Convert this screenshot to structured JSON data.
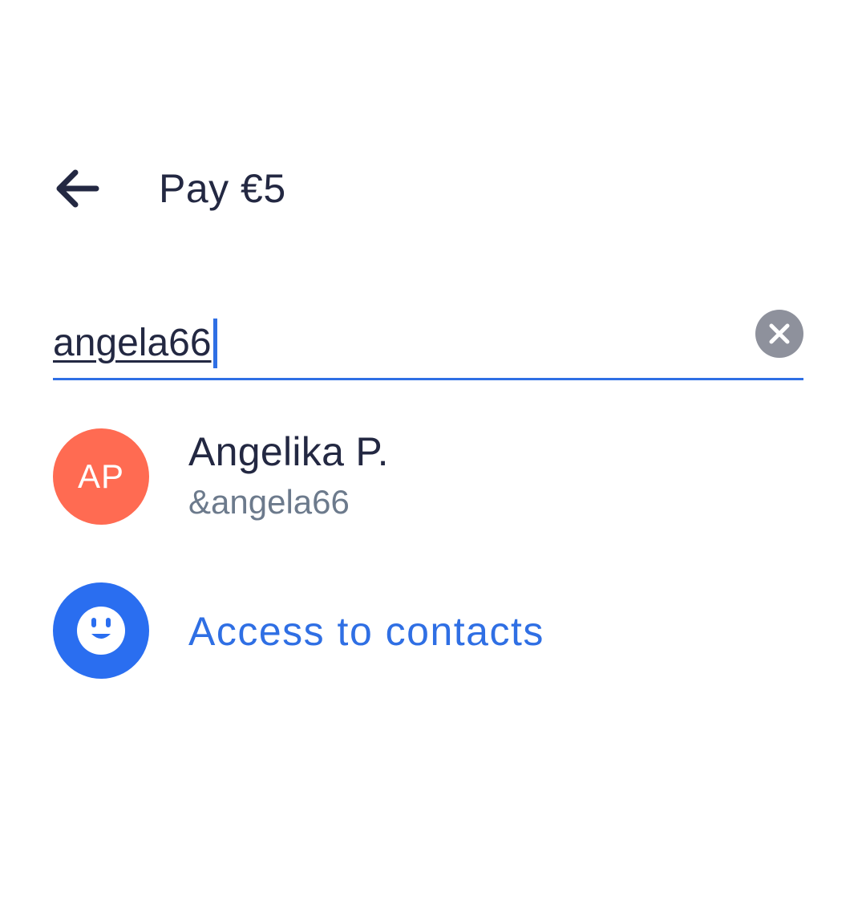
{
  "header": {
    "back_icon": "arrow-left-icon",
    "title": "Pay €5"
  },
  "search": {
    "value": "angela66",
    "clear_icon": "close-circle-icon"
  },
  "results": [
    {
      "initials": "AP",
      "name": "Angelika P.",
      "handle": "&angela66"
    }
  ],
  "access_contacts": {
    "label": "Access to contacts",
    "icon": "smiley-icon"
  },
  "colors": {
    "text": "#232842",
    "accent": "#2f6fe4",
    "avatar_bg": "#ff6b52",
    "contacts_icon_bg": "#2a6ef0",
    "muted_text": "#6c7a8c",
    "clear_bg": "#8e919c"
  }
}
